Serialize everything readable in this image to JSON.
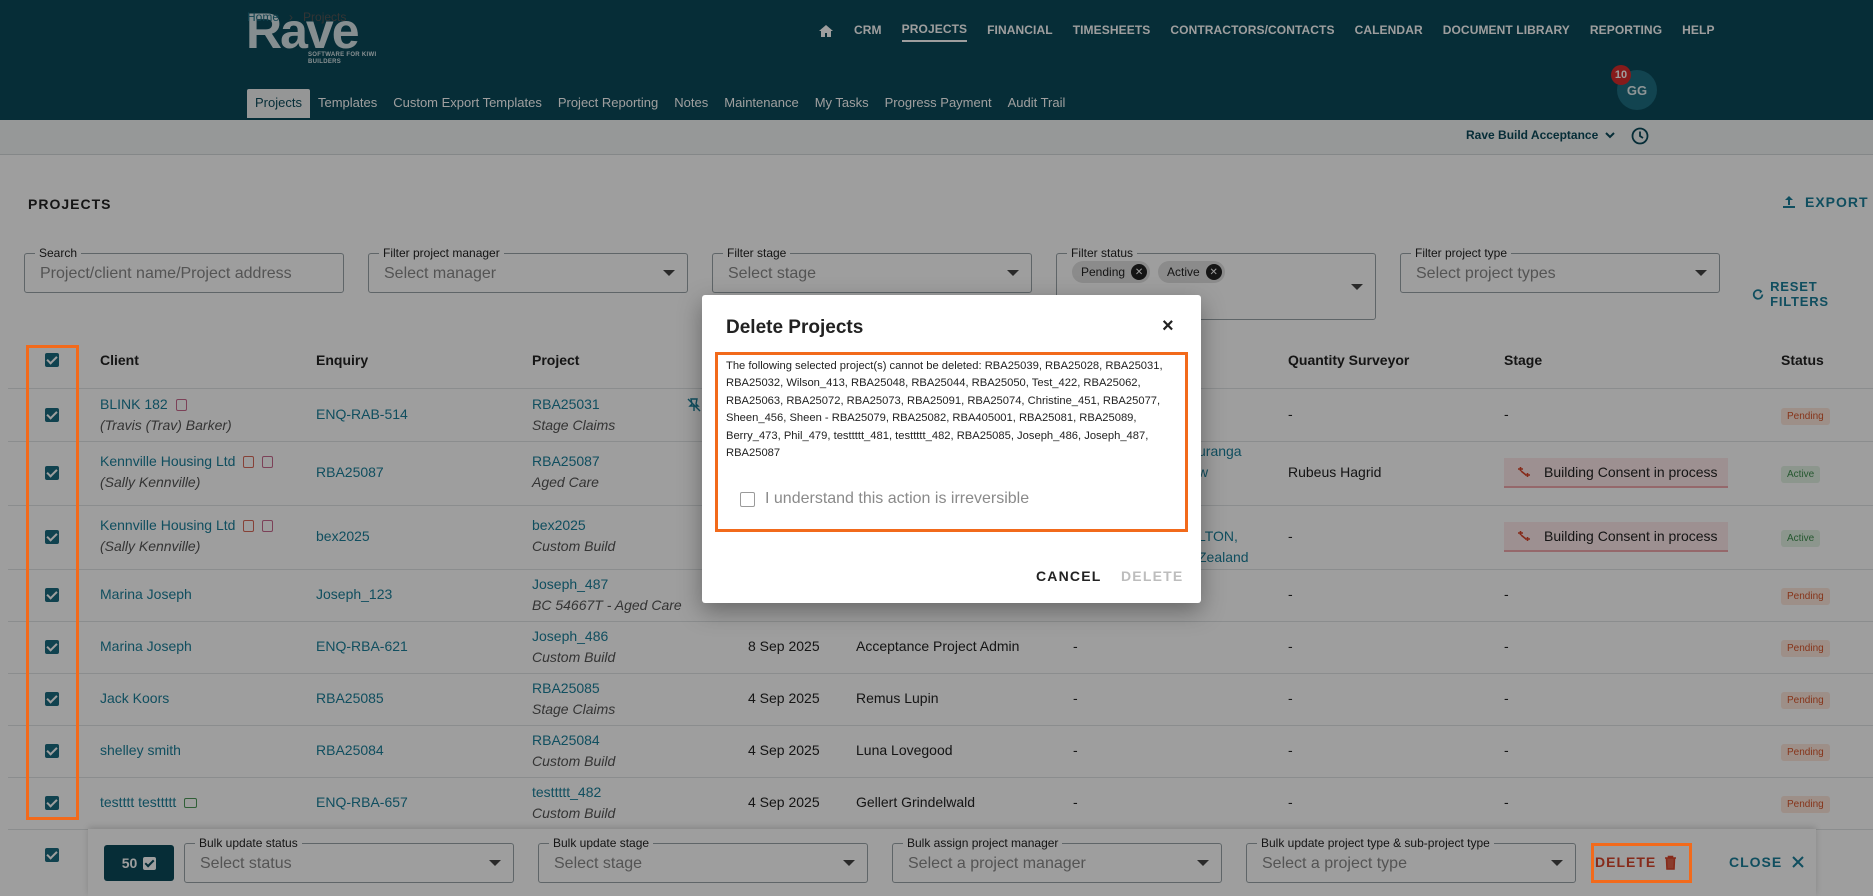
{
  "brand": {
    "logo_text": "Rave",
    "logo_sub": "SOFTWARE FOR KIWI BUILDERS"
  },
  "main_nav": [
    "CRM",
    "PROJECTS",
    "FINANCIAL",
    "TIMESHEETS",
    "CONTRACTORS/CONTACTS",
    "CALENDAR",
    "DOCUMENT LIBRARY",
    "REPORTING",
    "HELP"
  ],
  "sub_nav": [
    "Projects",
    "Templates",
    "Custom Export Templates",
    "Project Reporting",
    "Notes",
    "Maintenance",
    "My Tasks",
    "Progress Payment",
    "Audit Trail"
  ],
  "user": {
    "initials": "GG",
    "notifications": "10"
  },
  "breadcrumb": {
    "home": "Home",
    "sep": "›",
    "current": "Projects"
  },
  "company": "Rave Build Acceptance",
  "page": {
    "title": "PROJECTS",
    "export": "EXPORT",
    "reset": "RESET FILTERS"
  },
  "filters": {
    "search": {
      "label": "Search",
      "placeholder": "Project/client name/Project address"
    },
    "manager": {
      "label": "Filter project manager",
      "placeholder": "Select manager"
    },
    "stage": {
      "label": "Filter stage",
      "placeholder": "Select stage"
    },
    "status": {
      "label": "Filter status",
      "chips": [
        "Pending",
        "Active"
      ]
    },
    "type": {
      "label": "Filter project type",
      "placeholder": "Select project types"
    }
  },
  "table": {
    "headers": {
      "client": "Client",
      "enquiry": "Enquiry",
      "project": "Project",
      "qs": "Quantity Surveyor",
      "stage": "Stage",
      "status": "Status"
    },
    "rows": [
      {
        "client": "BLINK 182",
        "contact": "(Travis (Trav) Barker)",
        "enquiry": "ENQ-RAB-514",
        "project": "RBA25031",
        "ptype": "Stage Claims",
        "date": "",
        "manager": "",
        "col7": "",
        "qs": "-",
        "stage": "-",
        "status": "Pending"
      },
      {
        "client": "Kennville Housing Ltd",
        "contact": "(Sally Kennville)",
        "enquiry": "RBA25087",
        "project": "RBA25087",
        "ptype": "Aged Care",
        "date": "",
        "manager": "",
        "col7": "uranga",
        "col7b": "w",
        "qs": "Rubeus Hagrid",
        "stage": "Building Consent in process",
        "status": "Active"
      },
      {
        "client": "Kennville Housing Ltd",
        "contact": "(Sally Kennville)",
        "enquiry": "bex2025",
        "project": "bex2025",
        "ptype": "Custom Build",
        "date": "",
        "manager": "",
        "col7": "LTON,",
        "col7b": "Zealand",
        "qs": "-",
        "stage": "Building Consent in process",
        "status": "Active"
      },
      {
        "client": "Marina Joseph",
        "contact": "",
        "enquiry": "Joseph_123",
        "project": "Joseph_487",
        "ptype": "BC 54667T - Aged Care",
        "date": "",
        "manager": "",
        "col7": "",
        "qs": "-",
        "stage": "-",
        "status": "Pending"
      },
      {
        "client": "Marina Joseph",
        "contact": "",
        "enquiry": "ENQ-RBA-621",
        "project": "Joseph_486",
        "ptype": "Custom Build",
        "date": "8 Sep 2025",
        "manager": "Acceptance Project Admin",
        "col7": "-",
        "qs": "-",
        "stage": "-",
        "status": "Pending"
      },
      {
        "client": "Jack Koors",
        "contact": "",
        "enquiry": "RBA25085",
        "project": "RBA25085",
        "ptype": "Stage Claims",
        "date": "4 Sep 2025",
        "manager": "Remus Lupin",
        "col7": "-",
        "qs": "-",
        "stage": "-",
        "status": "Pending"
      },
      {
        "client": "shelley smith",
        "contact": "",
        "enquiry": "RBA25084",
        "project": "RBA25084",
        "ptype": "Custom Build",
        "date": "4 Sep 2025",
        "manager": "Luna Lovegood",
        "col7": "-",
        "qs": "-",
        "stage": "-",
        "status": "Pending"
      },
      {
        "client": "testttt testtttt",
        "contact": "",
        "enquiry": "ENQ-RBA-657",
        "project": "testtttt_482",
        "ptype": "Custom Build",
        "date": "4 Sep 2025",
        "manager": "Gellert Grindelwald",
        "col7": "-",
        "qs": "-",
        "stage": "-",
        "status": "Pending"
      }
    ]
  },
  "bulk": {
    "count": "50",
    "status": {
      "label": "Bulk update status",
      "placeholder": "Select status"
    },
    "stage": {
      "label": "Bulk update stage",
      "placeholder": "Select stage"
    },
    "manager": {
      "label": "Bulk assign project manager",
      "placeholder": "Select a project manager"
    },
    "type": {
      "label": "Bulk update project type & sub-project type",
      "placeholder": "Select a project type"
    },
    "delete": "DELETE",
    "close": "CLOSE"
  },
  "modal": {
    "title": "Delete Projects",
    "close": "×",
    "message": "The following selected project(s) cannot be deleted: RBA25039, RBA25028, RBA25031, RBA25032, Wilson_413, RBA25048, RBA25044, RBA25050, Test_422, RBA25062, RBA25063, RBA25072, RBA25073, RBA25091, RBA25074, Christine_451, RBA25077, Sheen_456, Sheen - RBA25079, RBA25082, RBA405001, RBA25081, RBA25089, Berry_473, Phil_479, testtttt_481, testtttt_482, RBA25085, Joseph_486, Joseph_487, RBA25087",
    "ack": "I understand this action is irreversible",
    "cancel": "CANCEL",
    "delete": "DELETE"
  },
  "colors": {
    "header": "#0b4a5a",
    "accent": "#1a7f99",
    "highlight": "#f26a1b"
  }
}
